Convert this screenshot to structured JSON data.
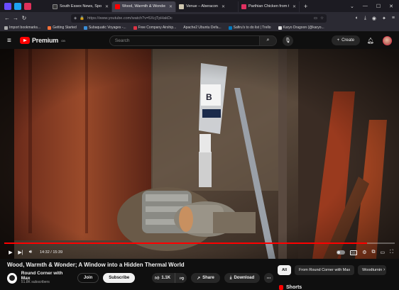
{
  "browser": {
    "tabs": [
      {
        "label": "South Essex News, Sport, Event",
        "color": "#3b3b3b",
        "active": false
      },
      {
        "label": "Wood, Warmth & Wonder; A Wi",
        "color": "#ff0000",
        "active": true
      },
      {
        "label": "Venue – Aberacon",
        "color": "#cfc7b0",
        "active": false
      },
      {
        "label": "Parthian Chicken from the Ron",
        "color": "#e03060",
        "active": false
      }
    ],
    "url": "https://www.youtube.com/watch?v=5XcjTpHakDc",
    "bookmarks": [
      "Import bookmarks...",
      "Getting Started",
      "Subaquatic Voyages -...",
      "Free Company Airship...",
      "Apache2 Ubuntu Defa...",
      "Safiru's to do list | Trello",
      "Karyo Dragoon (@karyo..."
    ]
  },
  "youtube": {
    "logo_text": "Premium",
    "logo_region": "GB",
    "search_placeholder": "Search",
    "create_label": "Create"
  },
  "player": {
    "time_current": "14:32",
    "time_total": "15:39",
    "progress_fraction": 0.929
  },
  "video": {
    "title": "Wood, Warmth & Wonder; A Window into a Hidden Thermal World",
    "channel_name": "Round Corner with Max",
    "subscribers": "51.8K subscribers",
    "join_label": "Join",
    "subscribe_label": "Subscribe",
    "likes": "1.1K",
    "share_label": "Share",
    "download_label": "Download"
  },
  "sidebar": {
    "chips": [
      "All",
      "From Round Corner with Max",
      "Woodturnin"
    ],
    "shorts_label": "Shorts"
  },
  "colors": {
    "accent": "#ff0000",
    "background": "#0f0f0f"
  }
}
